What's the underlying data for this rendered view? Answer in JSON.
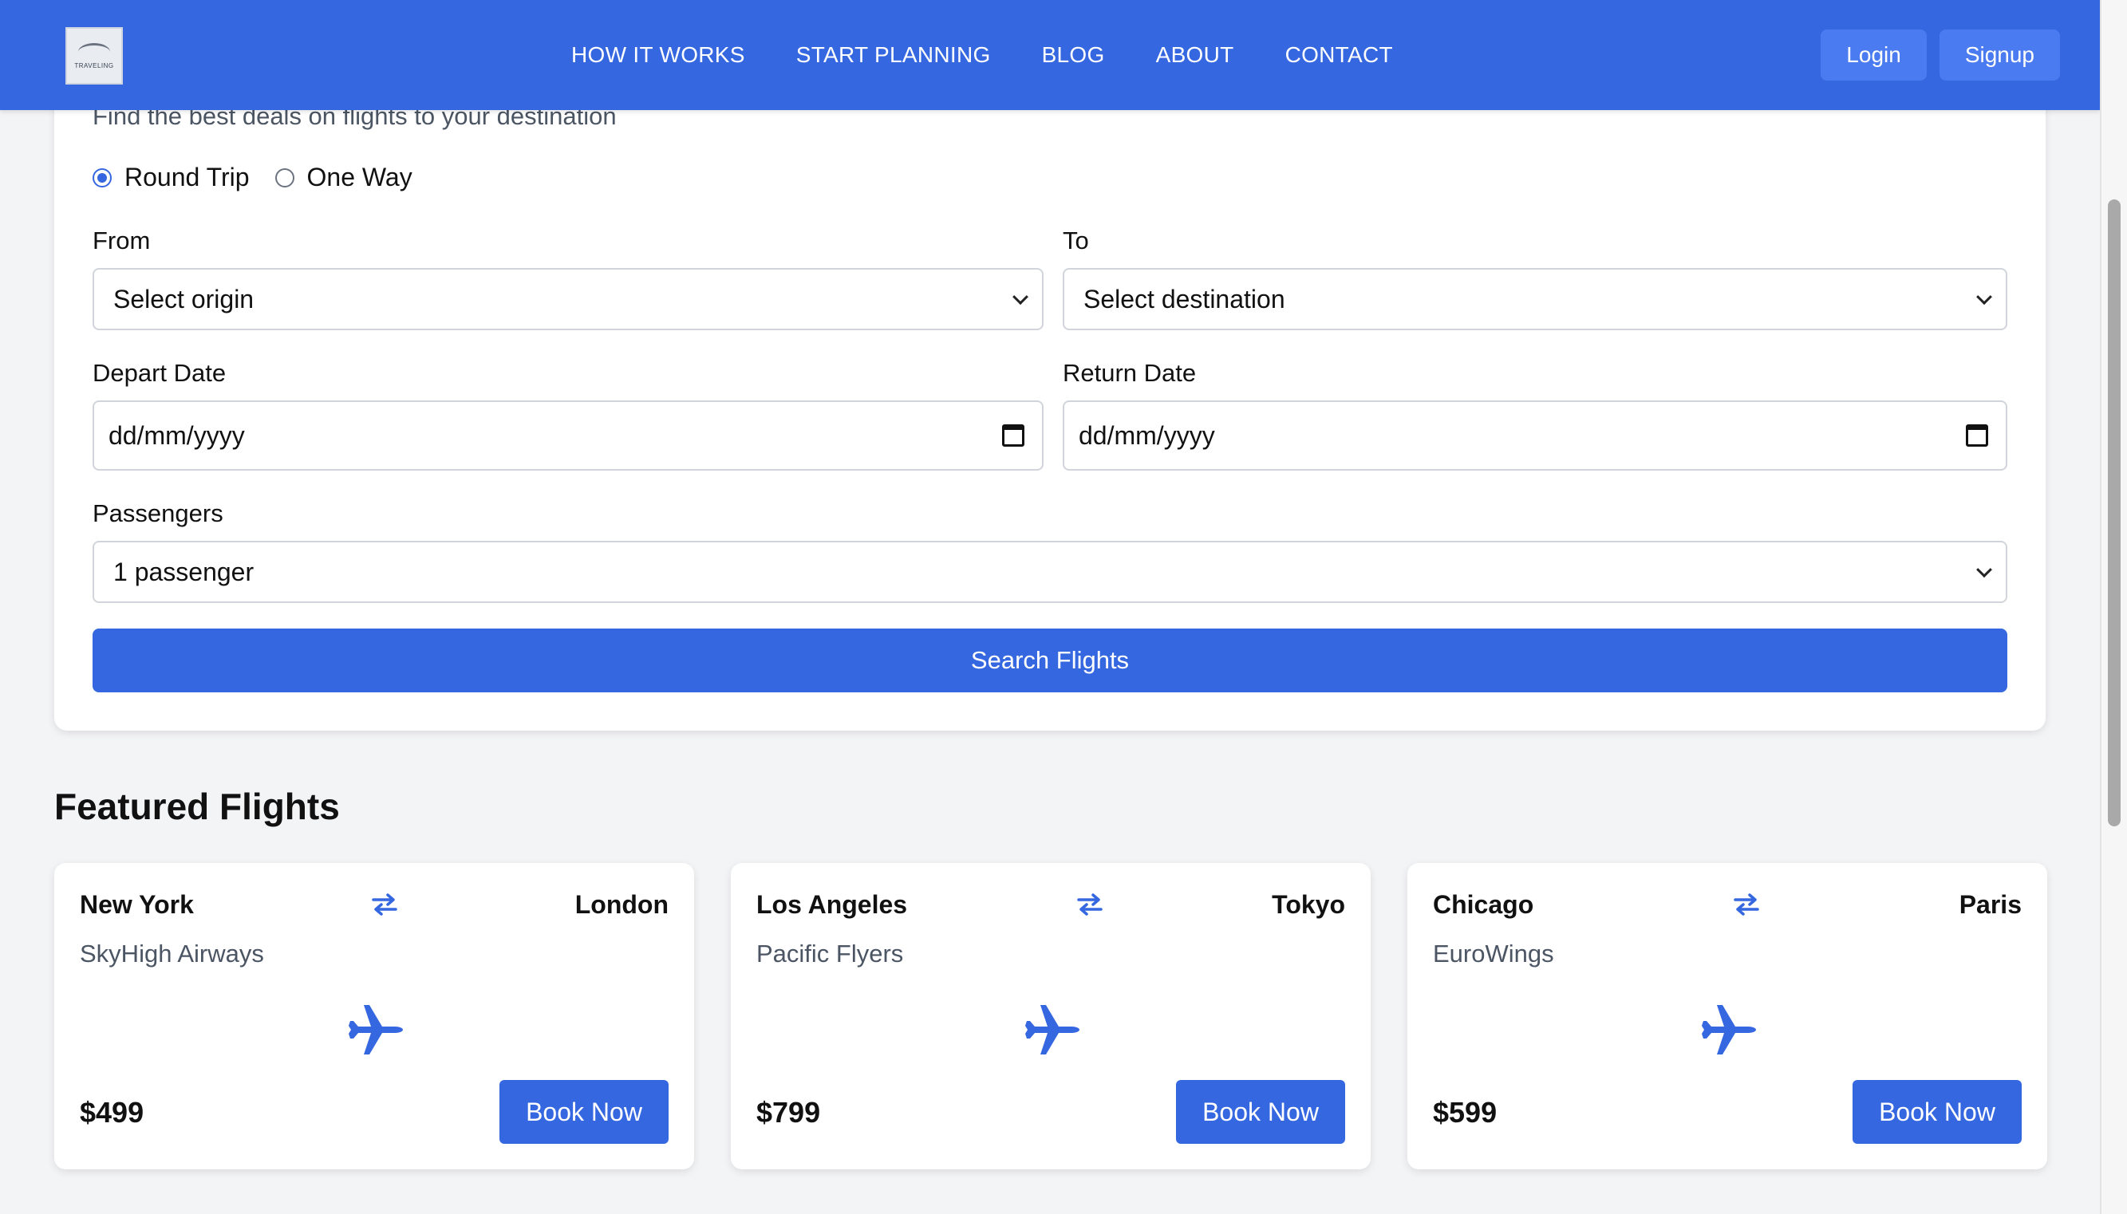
{
  "nav": {
    "logo_text": "TRAVELING",
    "links": [
      "HOW IT WORKS",
      "START PLANNING",
      "BLOG",
      "ABOUT",
      "CONTACT"
    ],
    "login_label": "Login",
    "signup_label": "Signup"
  },
  "search": {
    "subtitle": "Find the best deals on flights to your destination",
    "trip_types": [
      "Round Trip",
      "One Way"
    ],
    "selected_trip_type": "Round Trip",
    "from_label": "From",
    "from_value": "Select origin",
    "to_label": "To",
    "to_value": "Select destination",
    "depart_label": "Depart Date",
    "depart_value": "dd/mm/yyyy",
    "return_label": "Return Date",
    "return_value": "dd/mm/yyyy",
    "passengers_label": "Passengers",
    "passengers_value": "1 passenger",
    "button_label": "Search Flights"
  },
  "featured": {
    "title": "Featured Flights",
    "flights": [
      {
        "from": "New York",
        "to": "London",
        "airline": "SkyHigh Airways",
        "price": "$499",
        "button": "Book Now"
      },
      {
        "from": "Los Angeles",
        "to": "Tokyo",
        "airline": "Pacific Flyers",
        "price": "$799",
        "button": "Book Now"
      },
      {
        "from": "Chicago",
        "to": "Paris",
        "airline": "EuroWings",
        "price": "$599",
        "button": "Book Now"
      }
    ]
  },
  "colors": {
    "accent": "#3567e0",
    "nav_button": "#4a7bf0",
    "background": "#f3f4f6"
  },
  "icons": [
    "swap-arrows-icon",
    "plane-icon",
    "calendar-icon",
    "chevron-down-icon"
  ]
}
